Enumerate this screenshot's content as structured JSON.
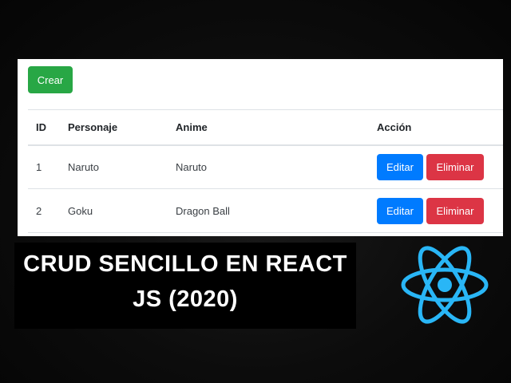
{
  "toolbar": {
    "create_label": "Crear"
  },
  "table": {
    "headers": [
      "ID",
      "Personaje",
      "Anime",
      "Acción"
    ],
    "rows": [
      {
        "id": "1",
        "personaje": "Naruto",
        "anime": "Naruto",
        "edit_label": "Editar",
        "delete_label": "Eliminar"
      },
      {
        "id": "2",
        "personaje": "Goku",
        "anime": "Dragon Ball",
        "edit_label": "Editar",
        "delete_label": "Eliminar"
      }
    ]
  },
  "title": {
    "line1": "CRUD SENCILLO EN REACT",
    "line2": "JS (2020)"
  },
  "logo": {
    "icon": "react-icon",
    "color": "#29b6f6"
  },
  "colors": {
    "success": "#28a745",
    "primary": "#007bff",
    "danger": "#dc3545"
  }
}
